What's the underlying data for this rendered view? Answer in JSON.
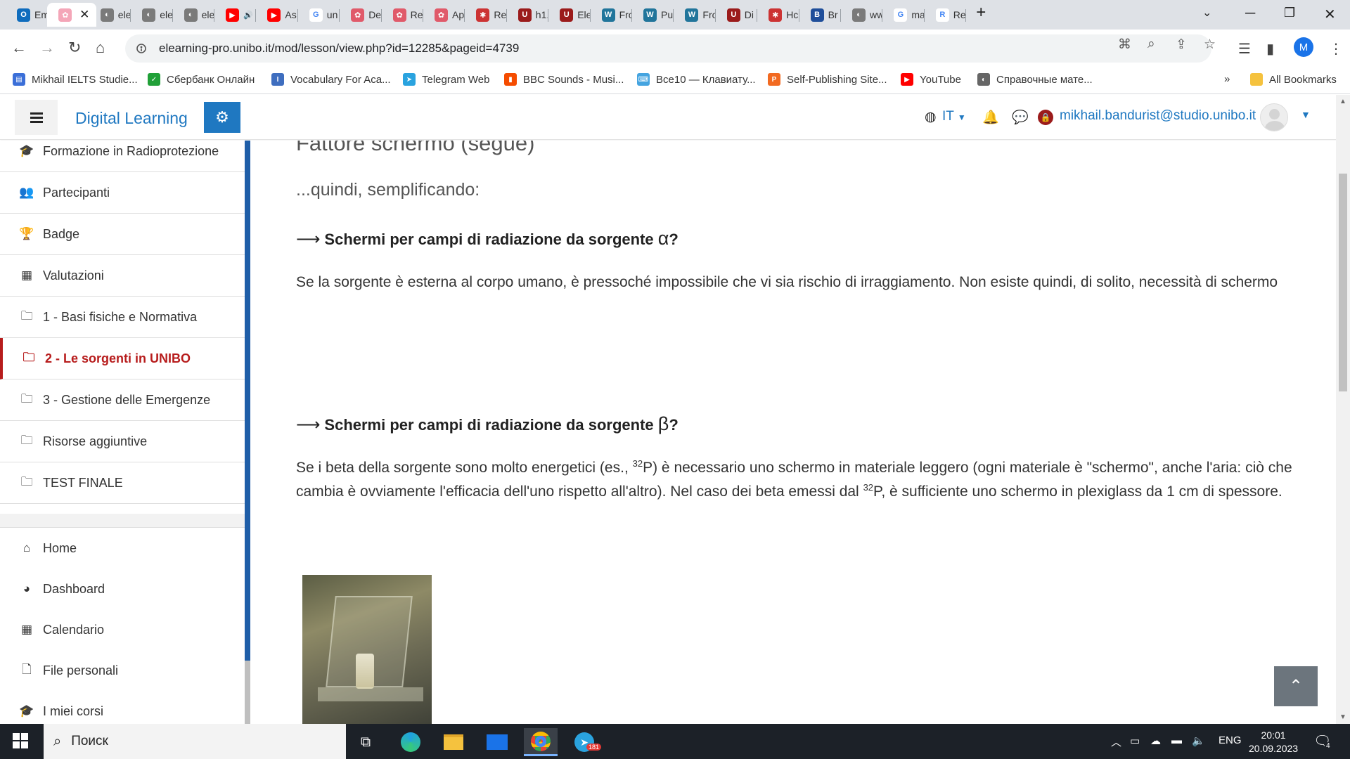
{
  "browser": {
    "tabs": [
      {
        "title": "Em",
        "icon": "outlook-icon",
        "color": "#0f6cbd",
        "glyph": "O"
      },
      {
        "title": "",
        "icon": "flower-icon",
        "color": "#f4a6b8",
        "glyph": "✿",
        "active": true
      },
      {
        "title": "ele",
        "icon": "globe-icon",
        "color": "#7a7a7a",
        "glyph": "◐"
      },
      {
        "title": "ele",
        "icon": "globe-icon",
        "color": "#7a7a7a",
        "glyph": "◐"
      },
      {
        "title": "ele",
        "icon": "globe-icon",
        "color": "#7a7a7a",
        "glyph": "◐"
      },
      {
        "title": "",
        "icon": "youtube-icon",
        "color": "#ff0000",
        "glyph": "▶",
        "audio": true
      },
      {
        "title": "As",
        "icon": "youtube-icon",
        "color": "#ff0000",
        "glyph": "▶"
      },
      {
        "title": "un",
        "icon": "google-icon",
        "color": "#ffffff",
        "glyph": "G"
      },
      {
        "title": "De",
        "icon": "flower-icon",
        "color": "#e05a6a",
        "glyph": "✿"
      },
      {
        "title": "Re",
        "icon": "flower-icon",
        "color": "#e05a6a",
        "glyph": "✿"
      },
      {
        "title": "Ap",
        "icon": "flower-icon",
        "color": "#e05a6a",
        "glyph": "✿"
      },
      {
        "title": "Re",
        "icon": "puzzle-icon",
        "color": "#cc3333",
        "glyph": "✱"
      },
      {
        "title": "h1.",
        "icon": "shield-icon",
        "color": "#9b1b1b",
        "glyph": "U"
      },
      {
        "title": "Ele",
        "icon": "shield-icon",
        "color": "#9b1b1b",
        "glyph": "U"
      },
      {
        "title": "Fro",
        "icon": "wordpress-icon",
        "color": "#21759b",
        "glyph": "W"
      },
      {
        "title": "Pu",
        "icon": "wordpress-icon",
        "color": "#21759b",
        "glyph": "W"
      },
      {
        "title": "Fro",
        "icon": "wordpress-icon",
        "color": "#21759b",
        "glyph": "W"
      },
      {
        "title": "Di",
        "icon": "shield-icon",
        "color": "#9b1b1b",
        "glyph": "U"
      },
      {
        "title": "Hc",
        "icon": "puzzle-icon",
        "color": "#cc3333",
        "glyph": "✱"
      },
      {
        "title": "Br",
        "icon": "doc-icon",
        "color": "#1f4e9a",
        "glyph": "B"
      },
      {
        "title": "ww",
        "icon": "globe-icon",
        "color": "#7a7a7a",
        "glyph": "◐"
      },
      {
        "title": "ma",
        "icon": "google-icon",
        "color": "#ffffff",
        "glyph": "G"
      },
      {
        "title": "Re",
        "icon": "r6-icon",
        "color": "#ffffff",
        "glyph": "R"
      }
    ],
    "url": "elearning-pro.unibo.it/mod/lesson/view.php?id=12285&pageid=4739",
    "profile_initial": "M",
    "bookmarks": [
      {
        "label": "Mikhail IELTS Studie...",
        "icon": "doc-icon",
        "color": "#3b6fd8",
        "glyph": "▤"
      },
      {
        "label": "Сбербанк Онлайн",
        "icon": "check-icon",
        "color": "#21a038",
        "glyph": "✓"
      },
      {
        "label": "Vocabulary For Aca...",
        "icon": "ielts-icon",
        "color": "#3f6ebf",
        "glyph": "I"
      },
      {
        "label": "Telegram Web",
        "icon": "telegram-icon",
        "color": "#2aa3df",
        "glyph": "➤"
      },
      {
        "label": "BBC Sounds - Musi...",
        "icon": "bbc-icon",
        "color": "#f54c00",
        "glyph": "▮"
      },
      {
        "label": "Все10 — Клавиату...",
        "icon": "keyboard-icon",
        "color": "#45a4e0",
        "glyph": "⌨"
      },
      {
        "label": "Self-Publishing Site...",
        "icon": "p-icon",
        "color": "#f26a21",
        "glyph": "P"
      },
      {
        "label": "YouTube",
        "icon": "youtube-icon",
        "color": "#ff0000",
        "glyph": "▶"
      },
      {
        "label": "Справочные мате...",
        "icon": "globe-icon",
        "color": "#666666",
        "glyph": "◐"
      }
    ],
    "more_label": "»",
    "all_bookmarks": "All Bookmarks"
  },
  "moodle": {
    "brand": "Digital Learning",
    "language": "IT",
    "user_email": "mikhail.bandurist@studio.unibo.it",
    "course_nav": [
      {
        "label": "Formazione in Radioprotezione",
        "icon": "graduation-cap-icon",
        "glyph": "🎓"
      },
      {
        "label": "Partecipanti",
        "icon": "users-icon",
        "glyph": "👥"
      },
      {
        "label": "Badge",
        "icon": "trophy-icon",
        "glyph": "🏆"
      },
      {
        "label": "Valutazioni",
        "icon": "table-icon",
        "glyph": "▦"
      },
      {
        "label": "1 - Basi fisiche e Normativa",
        "icon": "folder-icon",
        "glyph": "🗀"
      },
      {
        "label": "2 - Le sorgenti in UNIBO",
        "icon": "folder-icon",
        "glyph": "🗀",
        "current": true
      },
      {
        "label": "3 - Gestione delle Emergenze",
        "icon": "folder-icon",
        "glyph": "🗀"
      },
      {
        "label": "Risorse aggiuntive",
        "icon": "folder-icon",
        "glyph": "🗀"
      },
      {
        "label": "TEST FINALE",
        "icon": "folder-icon",
        "glyph": "🗀"
      }
    ],
    "site_nav": [
      {
        "label": "Home",
        "icon": "home-icon",
        "glyph": "⌂"
      },
      {
        "label": "Dashboard",
        "icon": "dashboard-icon",
        "glyph": "◕"
      },
      {
        "label": "Calendario",
        "icon": "calendar-icon",
        "glyph": "▦"
      },
      {
        "label": "File personali",
        "icon": "file-icon",
        "glyph": "🗋"
      },
      {
        "label": "I miei corsi",
        "icon": "graduation-cap-icon",
        "glyph": "🎓"
      }
    ]
  },
  "lesson": {
    "heading": "Fattore schermo (segue)",
    "intro": "...quindi, semplificando:",
    "sections": [
      {
        "arrow": "⟶",
        "title": "Schermi per campi di radiazione da sorgente",
        "greek": "α",
        "suffix": "?",
        "body": "Se la sorgente è esterna al corpo umano, è pressoché impossibile che vi sia rischio di irraggiamento. Non esiste quindi, di solito, necessità di schermo"
      },
      {
        "arrow": "⟶",
        "title": "Schermi per campi di radiazione da sorgente",
        "greek": "β",
        "suffix": "?",
        "body_parts": [
          "Se i beta della sorgente sono molto energetici (es., ",
          "32",
          "P) è necessario uno schermo in materiale leggero (ogni materiale è \"schermo\", anche l'aria: ciò che cambia è ovviamente l'efficacia dell'uno rispetto all'altro). Nel caso dei beta emessi dal ",
          "32",
          "P, è sufficiente uno schermo in plexiglass da 1 cm di spessore."
        ]
      }
    ]
  },
  "taskbar": {
    "search_placeholder": "Поиск",
    "language": "ENG",
    "time": "20:01",
    "date": "20.09.2023",
    "telegram_badge": "181",
    "notifications": "4"
  }
}
